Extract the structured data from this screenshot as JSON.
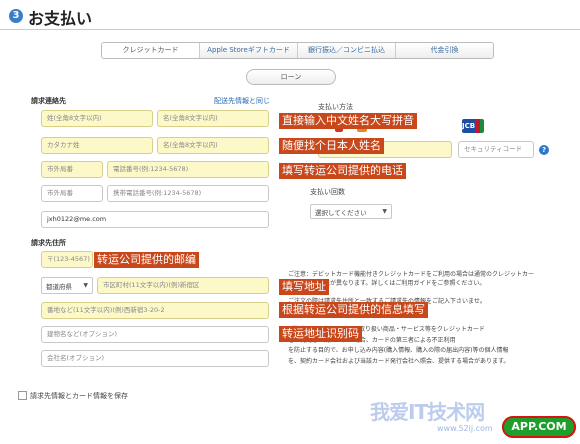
{
  "header": {
    "step": "3",
    "title": "お支払い"
  },
  "tabs": [
    {
      "label": "クレジットカード"
    },
    {
      "label": "Apple Storeギフトカード"
    },
    {
      "label": "銀行振込／コンビニ払込"
    },
    {
      "label": "代金引換"
    }
  ],
  "loan_button": "ローン",
  "billing_contact": {
    "section_label": "請求連絡先",
    "link": "配送先情報と同じ",
    "last_name_ph": "姓(全角8文字以内)",
    "first_name_ph": "名(全角8文字以内)",
    "last_kana_ph": "カタカナ姓",
    "first_kana_ph": "カタカナ名",
    "area_code_ph": "市外局番",
    "phone_ph": "電話番号(例:1234-5678)",
    "area_code2_ph": "市外局番",
    "mobile_ph": "携帯電話番号(例:1234-5678)",
    "email_value": "jxh0122@me.com"
  },
  "billing_address": {
    "section_label": "請求先住所",
    "zip_ph": "〒(123-4567)",
    "prefecture": "都道府県",
    "city_ph": "市区町村(11文字以内)(例)新宿区",
    "street_ph": "番地など(11文字以内)(例)西新宿3-20-2",
    "building_ph": "建物名など(オプション)",
    "company_ph": "会社名(オプション)"
  },
  "payment": {
    "section_label": "支払い方法",
    "security_code_ph": "セキュリティコード",
    "installments_label": "支払い回数",
    "select_value": "選択してください",
    "notice_lines": [
      "ご注意：デビットカード機能付きクレジットカードをご利用の場合は通常のクレジットカー",
      "ドと支払い方法が異なります。詳しくはご利用ガイドをご参照ください。",
      "ご注文の際は請求先住所と一致するご請求先の情報をご記入下さいませ。",
      "ご注意：Apple Storeは、取り扱い商品・サービス等をクレジットカード",
      "をご利用して購入された場合、カードの第三者による不正利用",
      "を防止する目的で、お申し込み内容(購入情報、購入の際の届出内容)等の個人情報",
      "を、契約カード会社および当該カード発行会社へ照会、提供する場合があります。"
    ]
  },
  "save_checkbox_label": "請求先情報とカード情報を保存",
  "annotations": {
    "a1": "直接输入中文姓名大写拼音",
    "a2": "随便找个日本人姓名",
    "a3": "填写转运公司提供的电话",
    "a4": "转运公司提供的邮编",
    "a5": "填写地址",
    "a6": "根据转运公司提供的信息填写",
    "a7": "转运地址识别码"
  },
  "card_logos": {
    "jcb": "JCB"
  },
  "watermark": {
    "text": "我爱IT技术网",
    "url": "www.52ij.com",
    "badge": "APP.COM"
  },
  "colors": {
    "annotation": "#c8481c",
    "link": "#2a6ab0",
    "required_field": "#fdf8c8"
  }
}
